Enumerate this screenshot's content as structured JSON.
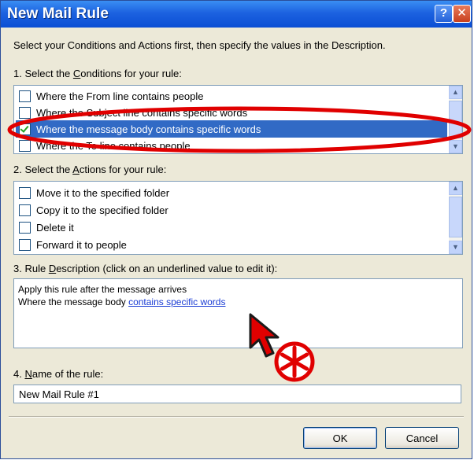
{
  "window": {
    "title": "New Mail Rule"
  },
  "titlebar": {
    "help_glyph": "?",
    "close_glyph": "✕"
  },
  "intro": "Select your Conditions and Actions first, then specify the values in the Description.",
  "step1": {
    "prefix": "1. Select the ",
    "accel": "C",
    "rest": "onditions for your rule:"
  },
  "conditions": [
    {
      "label": "Where the From line contains people",
      "checked": false
    },
    {
      "label": "Where the Subject line contains specific words",
      "checked": false
    },
    {
      "label": "Where the message body contains specific words",
      "checked": true,
      "selected": true
    },
    {
      "label": "Where the To line contains people",
      "checked": false
    }
  ],
  "step2": {
    "prefix": "2. Select the ",
    "accel": "A",
    "rest": "ctions for your rule:"
  },
  "actions": [
    {
      "label": "Move it to the specified folder",
      "checked": false
    },
    {
      "label": "Copy it to the specified folder",
      "checked": false
    },
    {
      "label": "Delete it",
      "checked": false
    },
    {
      "label": "Forward it to people",
      "checked": false
    }
  ],
  "step3": {
    "prefix": "3. Rule ",
    "accel": "D",
    "rest": "escription (click on an underlined value to edit it):"
  },
  "description": {
    "line1": "Apply this rule after the message arrives",
    "line2_prefix": "Where the message body ",
    "line2_link": "contains specific words"
  },
  "step4": {
    "prefix": "4. ",
    "accel": "N",
    "rest": "ame of the rule:"
  },
  "rule_name": {
    "value": "New Mail Rule #1"
  },
  "buttons": {
    "ok": "OK",
    "cancel": "Cancel"
  },
  "icons": {
    "scroll_up": "▲",
    "scroll_down": "▼"
  },
  "colors": {
    "selection": "#316ac5",
    "annotation": "#e00000",
    "titlebar": "#0b4ed4"
  }
}
